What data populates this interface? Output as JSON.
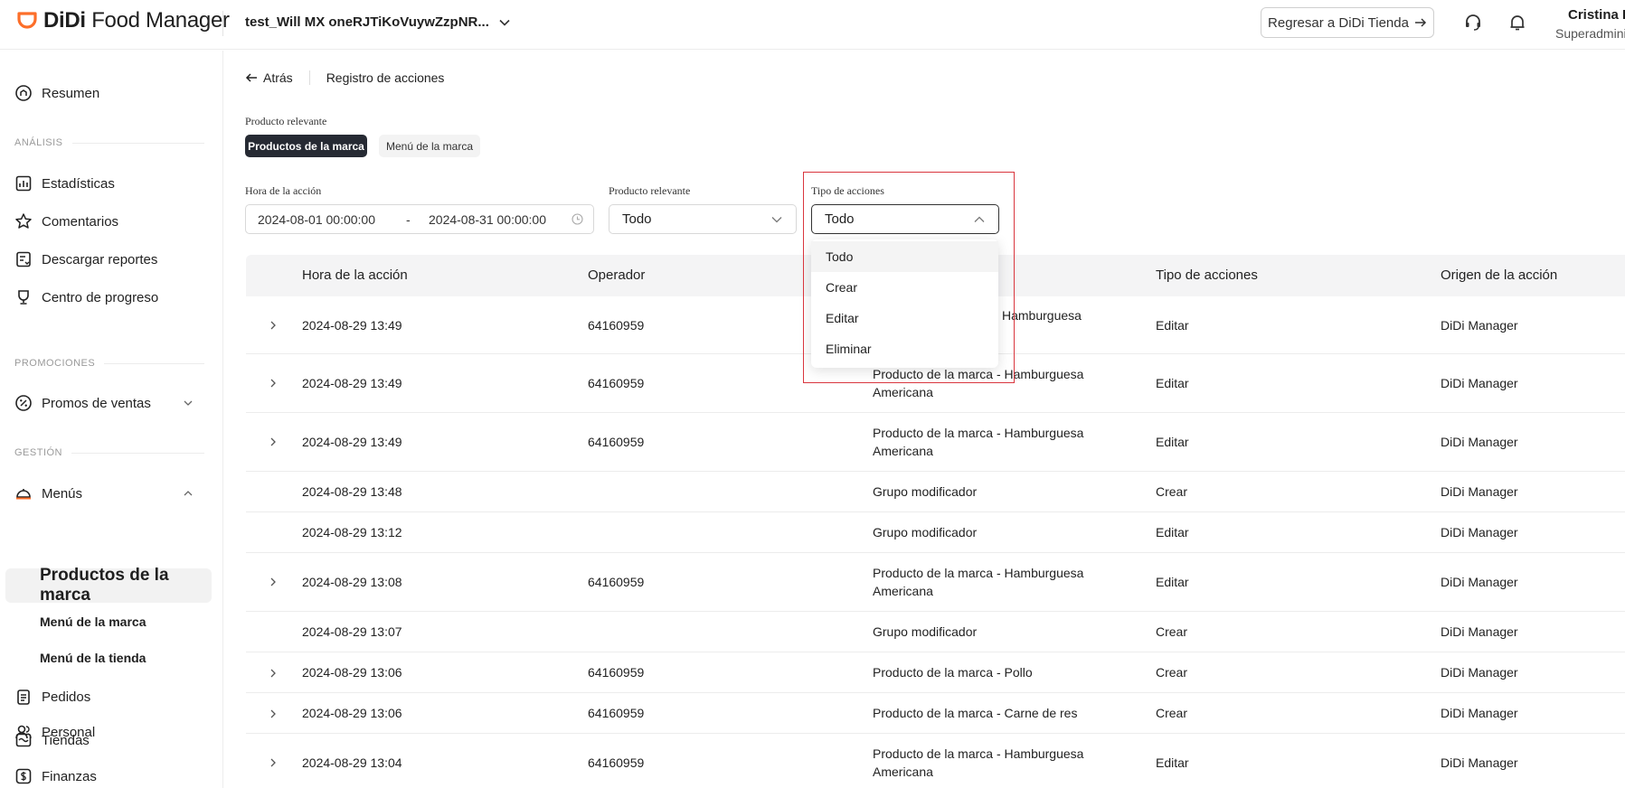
{
  "header": {
    "logo_didi": "DiDi",
    "logo_rest": "Food Manager",
    "store_name": "test_Will MX oneRJTiKoVuywZzpNR...",
    "back_store_label": "Regresar a DiDi Tienda",
    "user_name": "Cristina D",
    "user_role": "Superadmini",
    "brand_color": "#fc6e29"
  },
  "sidebar": {
    "resumen": "Resumen",
    "section_analisis": "ANÁLISIS",
    "estadisticas": "Estadísticas",
    "comentarios": "Comentarios",
    "descargar": "Descargar reportes",
    "centro": "Centro de progreso",
    "section_promociones": "PROMOCIONES",
    "promos": "Promos de ventas",
    "section_gestion": "GESTIÓN",
    "menus": "Menús",
    "productos_marca": "Productos de la marca",
    "menu_marca": "Menú de la marca",
    "menu_tienda": "Menú de la tienda",
    "pedidos": "Pedidos",
    "tiendas": "Tiendas",
    "personal": "Personal",
    "finanzas": "Finanzas"
  },
  "main": {
    "back_label": "Atrás",
    "page_title": "Registro de acciones",
    "relevant_label": "Producto relevante",
    "chip_active": "Productos de la marca",
    "chip_inactive": "Menú de la marca",
    "filter_time_label": "Hora de la acción",
    "date_start": "2024-08-01 00:00:00",
    "date_sep": "-",
    "date_end": "2024-08-31 00:00:00",
    "filter_product_label": "Producto relevante",
    "filter_product_value": "Todo",
    "filter_type_label": "Tipo de acciones",
    "filter_type_value": "Todo",
    "dropdown_options": [
      "Todo",
      "Crear",
      "Editar",
      "Eliminar"
    ]
  },
  "table": {
    "headers": {
      "time": "Hora de la acción",
      "operator": "Operador",
      "type": "Tipo de acciones",
      "origin": "Origen de la acción"
    },
    "rows": [
      {
        "time": "2024-08-29 13:49",
        "operator": "64160959",
        "product_l1": "Hamburguesa",
        "product_l2": "",
        "type": "Editar",
        "origin": "DiDi Manager"
      },
      {
        "time": "2024-08-29 13:49",
        "operator": "64160959",
        "product_l1": "Producto de la marca - Hamburguesa",
        "product_l2": "Americana",
        "type": "Editar",
        "origin": "DiDi Manager"
      },
      {
        "time": "2024-08-29 13:49",
        "operator": "64160959",
        "product_l1": "Producto de la marca - Hamburguesa",
        "product_l2": "Americana",
        "type": "Editar",
        "origin": "DiDi Manager"
      },
      {
        "time": "2024-08-29 13:48",
        "operator": "",
        "product_l1": "Grupo modificador",
        "product_l2": "",
        "type": "Crear",
        "origin": "DiDi Manager"
      },
      {
        "time": "2024-08-29 13:12",
        "operator": "",
        "product_l1": "Grupo modificador",
        "product_l2": "",
        "type": "Editar",
        "origin": "DiDi Manager"
      },
      {
        "time": "2024-08-29 13:08",
        "operator": "64160959",
        "product_l1": "Producto de la marca - Hamburguesa",
        "product_l2": "Americana",
        "type": "Editar",
        "origin": "DiDi Manager"
      },
      {
        "time": "2024-08-29 13:07",
        "operator": "",
        "product_l1": "Grupo modificador",
        "product_l2": "",
        "type": "Crear",
        "origin": "DiDi Manager"
      },
      {
        "time": "2024-08-29 13:06",
        "operator": "64160959",
        "product_l1": "Producto de la marca - Pollo",
        "product_l2": "",
        "type": "Crear",
        "origin": "DiDi Manager"
      },
      {
        "time": "2024-08-29 13:06",
        "operator": "64160959",
        "product_l1": "Producto de la marca - Carne de res",
        "product_l2": "",
        "type": "Crear",
        "origin": "DiDi Manager"
      },
      {
        "time": "2024-08-29 13:04",
        "operator": "64160959",
        "product_l1": "Producto de la marca - Hamburguesa",
        "product_l2": "Americana",
        "type": "Editar",
        "origin": "DiDi Manager"
      }
    ]
  }
}
